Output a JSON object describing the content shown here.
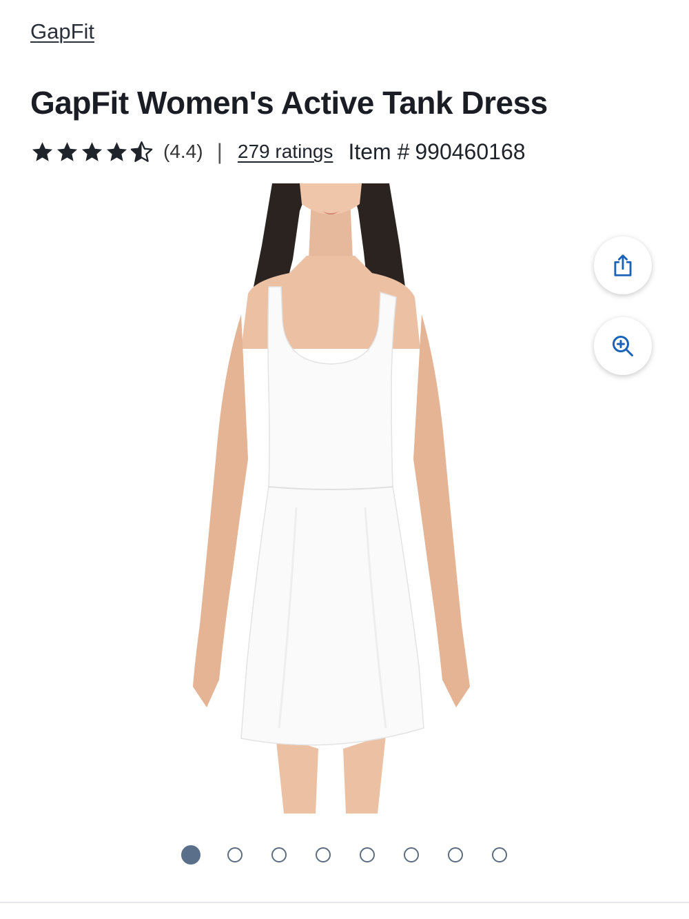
{
  "brand": {
    "label": "GapFit"
  },
  "product": {
    "title": "GapFit Women's Active Tank Dress",
    "rating_value": "(4.4)",
    "rating_stars": 4.4,
    "separator": "|",
    "ratings_count": "279 ratings",
    "item_label": "Item #",
    "item_number": "990460168"
  },
  "icons": {
    "share": "share-icon",
    "zoom": "zoom-in-icon",
    "star": "star-icon"
  },
  "carousel": {
    "total": 8,
    "active_index": 0
  },
  "colors": {
    "accent": "#1a62b8",
    "text": "#1a1d24",
    "dot_active": "#5a6f8a"
  }
}
